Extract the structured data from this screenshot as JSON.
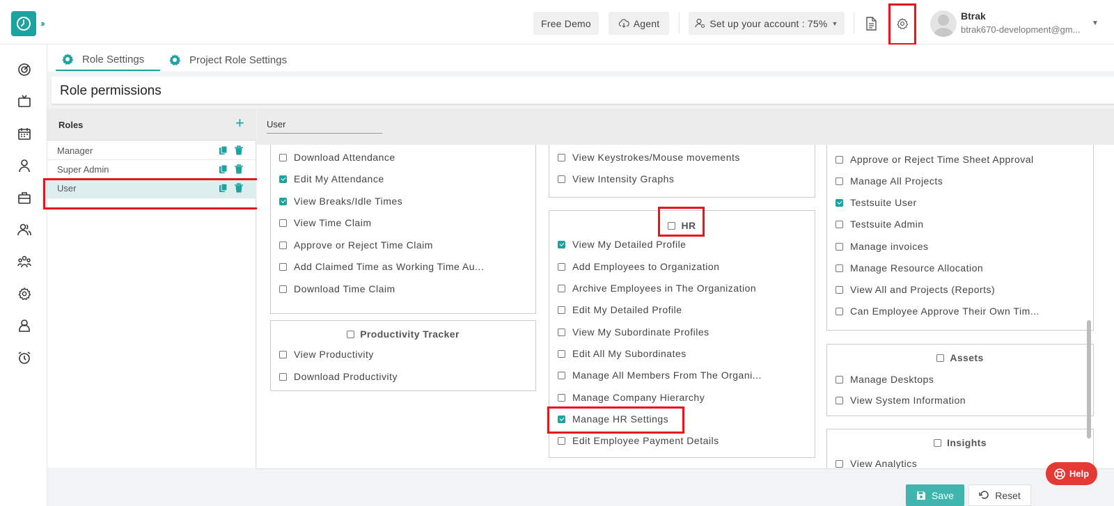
{
  "header": {
    "free_demo": "Free Demo",
    "agent": "Agent",
    "setup": "Set up your account : 75%",
    "user_name": "Btrak",
    "user_email": "btrak670-development@gm..."
  },
  "tabs": [
    {
      "label": "Role Settings"
    },
    {
      "label": "Project Role Settings"
    }
  ],
  "page_title": "Role permissions",
  "roles": {
    "title": "Roles",
    "items": [
      {
        "name": "Manager"
      },
      {
        "name": "Super Admin"
      },
      {
        "name": "User"
      }
    ]
  },
  "selected_role": "User",
  "columns": {
    "col1": {
      "box1": {
        "items": [
          {
            "label": "Download Attendance",
            "checked": false
          },
          {
            "label": "Edit My Attendance",
            "checked": true
          },
          {
            "label": "View Breaks/Idle Times",
            "checked": true
          },
          {
            "label": "View Time Claim",
            "checked": false
          },
          {
            "label": "Approve or Reject Time Claim",
            "checked": false
          },
          {
            "label": "Add Claimed Time as Working Time Au...",
            "checked": false
          },
          {
            "label": "Download Time Claim",
            "checked": false
          }
        ]
      },
      "productivity": {
        "title": "Productivity Tracker",
        "items": [
          {
            "label": "View Productivity",
            "checked": false
          },
          {
            "label": "Download Productivity",
            "checked": false
          }
        ]
      }
    },
    "col2": {
      "box1": {
        "items": [
          {
            "label": "View Keystrokes/Mouse movements",
            "checked": false
          },
          {
            "label": "View Intensity Graphs",
            "checked": false
          }
        ]
      },
      "hr": {
        "title": "HR",
        "items": [
          {
            "label": "View My Detailed Profile",
            "checked": true
          },
          {
            "label": "Add Employees to Organization",
            "checked": false
          },
          {
            "label": "Archive Employees in The Organization",
            "checked": false
          },
          {
            "label": "Edit My Detailed Profile",
            "checked": false
          },
          {
            "label": "View My Subordinate Profiles",
            "checked": false
          },
          {
            "label": "Edit All My Subordinates",
            "checked": false
          },
          {
            "label": "Manage All Members From The Organi...",
            "checked": false
          },
          {
            "label": "Manage Company Hierarchy",
            "checked": false
          },
          {
            "label": "Manage HR Settings",
            "checked": true
          },
          {
            "label": "Edit Employee Payment Details",
            "checked": false
          }
        ]
      }
    },
    "col3": {
      "box1": {
        "items": [
          {
            "label": "Approve or Reject Time Sheet Approval",
            "checked": false
          },
          {
            "label": "Manage All Projects",
            "checked": false
          },
          {
            "label": "Testsuite User",
            "checked": true
          },
          {
            "label": "Testsuite Admin",
            "checked": false
          },
          {
            "label": "Manage invoices",
            "checked": false
          },
          {
            "label": "Manage Resource Allocation",
            "checked": false
          },
          {
            "label": "View All and Projects (Reports)",
            "checked": false
          },
          {
            "label": "Can Employee Approve Their Own Tim...",
            "checked": false
          }
        ]
      },
      "assets": {
        "title": "Assets",
        "items": [
          {
            "label": "Manage Desktops",
            "checked": false
          },
          {
            "label": "View System Information",
            "checked": false
          }
        ]
      },
      "insights": {
        "title": "Insights",
        "items": [
          {
            "label": "View Analytics",
            "checked": false
          }
        ]
      }
    }
  },
  "buttons": {
    "save": "Save",
    "reset": "Reset",
    "help": "Help"
  },
  "colors": {
    "accent": "#1aa3a0",
    "highlight": "#e8141c"
  }
}
